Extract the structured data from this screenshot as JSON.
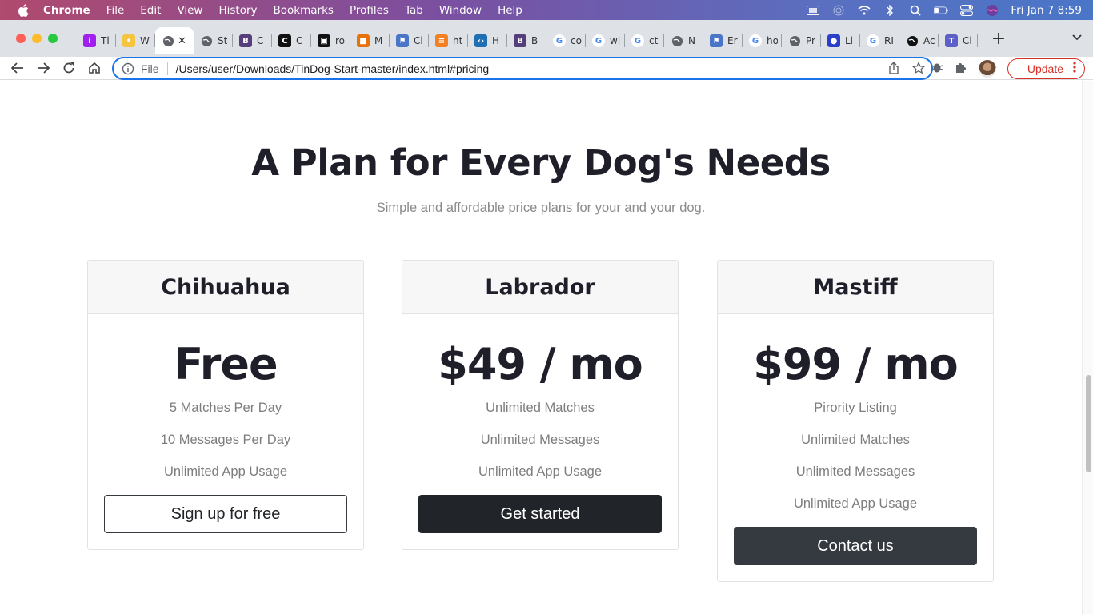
{
  "menubar": {
    "app_name": "Chrome",
    "items": [
      "File",
      "Edit",
      "View",
      "History",
      "Bookmarks",
      "Profiles",
      "Tab",
      "Window",
      "Help"
    ],
    "clock": "Fri Jan 7  8:59"
  },
  "tabs": [
    {
      "title": "Tl",
      "favicon": "letter-circle",
      "color": "#a020f0",
      "letter": "i"
    },
    {
      "title": "W",
      "favicon": "lock-emoji",
      "color": "#f5c542",
      "letter": "•"
    },
    {
      "title": "",
      "favicon": "globe-icon",
      "color": "#5f6368",
      "letter": "",
      "active": true
    },
    {
      "title": "St",
      "favicon": "globe-icon",
      "color": "#5f6368",
      "letter": ""
    },
    {
      "title": "C",
      "favicon": "bootstrap-icon",
      "color": "#563d7c",
      "letter": "B"
    },
    {
      "title": "C",
      "favicon": "c-icon",
      "color": "#111111",
      "letter": "C"
    },
    {
      "title": "ro",
      "favicon": "black-square-icon",
      "color": "#111111",
      "letter": "▣"
    },
    {
      "title": "M",
      "favicon": "colorful-icon",
      "color": "#e8710a",
      "letter": "■"
    },
    {
      "title": "Cl",
      "favicon": "flag-icon",
      "color": "#4a76c8",
      "letter": "⚑"
    },
    {
      "title": "ht",
      "favicon": "stackoverflow-icon",
      "color": "#f48024",
      "letter": "≡"
    },
    {
      "title": "H",
      "favicon": "code-icon",
      "color": "#1f6fb2",
      "letter": "‹›"
    },
    {
      "title": "B",
      "favicon": "bootstrap-icon",
      "color": "#563d7c",
      "letter": "B"
    },
    {
      "title": "co",
      "favicon": "google-icon",
      "color": "#4285f4",
      "letter": "G"
    },
    {
      "title": "wl",
      "favicon": "google-icon",
      "color": "#4285f4",
      "letter": "G"
    },
    {
      "title": "ct",
      "favicon": "google-icon",
      "color": "#4285f4",
      "letter": "G"
    },
    {
      "title": "N",
      "favicon": "chrome-icon",
      "color": "#5f6368",
      "letter": "◉"
    },
    {
      "title": "Er",
      "favicon": "flag-icon",
      "color": "#4a76c8",
      "letter": "⚑"
    },
    {
      "title": "ho",
      "favicon": "google-icon",
      "color": "#4285f4",
      "letter": "G"
    },
    {
      "title": "Pr",
      "favicon": "globe-icon",
      "color": "#5f6368",
      "letter": ""
    },
    {
      "title": "Li",
      "favicon": "blue-circle-icon",
      "color": "#2b3fc9",
      "letter": "●"
    },
    {
      "title": "RI",
      "favicon": "google-icon",
      "color": "#4285f4",
      "letter": "G"
    },
    {
      "title": "Ac",
      "favicon": "github-icon",
      "color": "#111111",
      "letter": "◎"
    },
    {
      "title": "Cl",
      "favicon": "teams-icon",
      "color": "#5b5fc7",
      "letter": "T"
    }
  ],
  "toolbar": {
    "scheme": "File",
    "url": "/Users/user/Downloads/TinDog-Start-master/index.html#pricing",
    "update_label": "Update"
  },
  "pricing": {
    "title": "A Plan for Every Dog's Needs",
    "subtitle": "Simple and affordable price plans for your and your dog.",
    "plans": [
      {
        "name": "Chihuahua",
        "price": "Free",
        "features": [
          "5 Matches Per Day",
          "10 Messages Per Day",
          "Unlimited App Usage"
        ],
        "button": "Sign up for free"
      },
      {
        "name": "Labrador",
        "price": "$49 / mo",
        "features": [
          "Unlimited Matches",
          "Unlimited Messages",
          "Unlimited App Usage"
        ],
        "button": "Get started"
      },
      {
        "name": "Mastiff",
        "price": "$99 / mo",
        "features": [
          "Pirority Listing",
          "Unlimited Matches",
          "Unlimited Messages",
          "Unlimited App Usage"
        ],
        "button": "Contact us"
      }
    ]
  },
  "colors": {
    "accent_blue": "#1a73e8",
    "update_red": "#d93025",
    "dark_button": "#212529",
    "gray_button": "#343a40"
  }
}
